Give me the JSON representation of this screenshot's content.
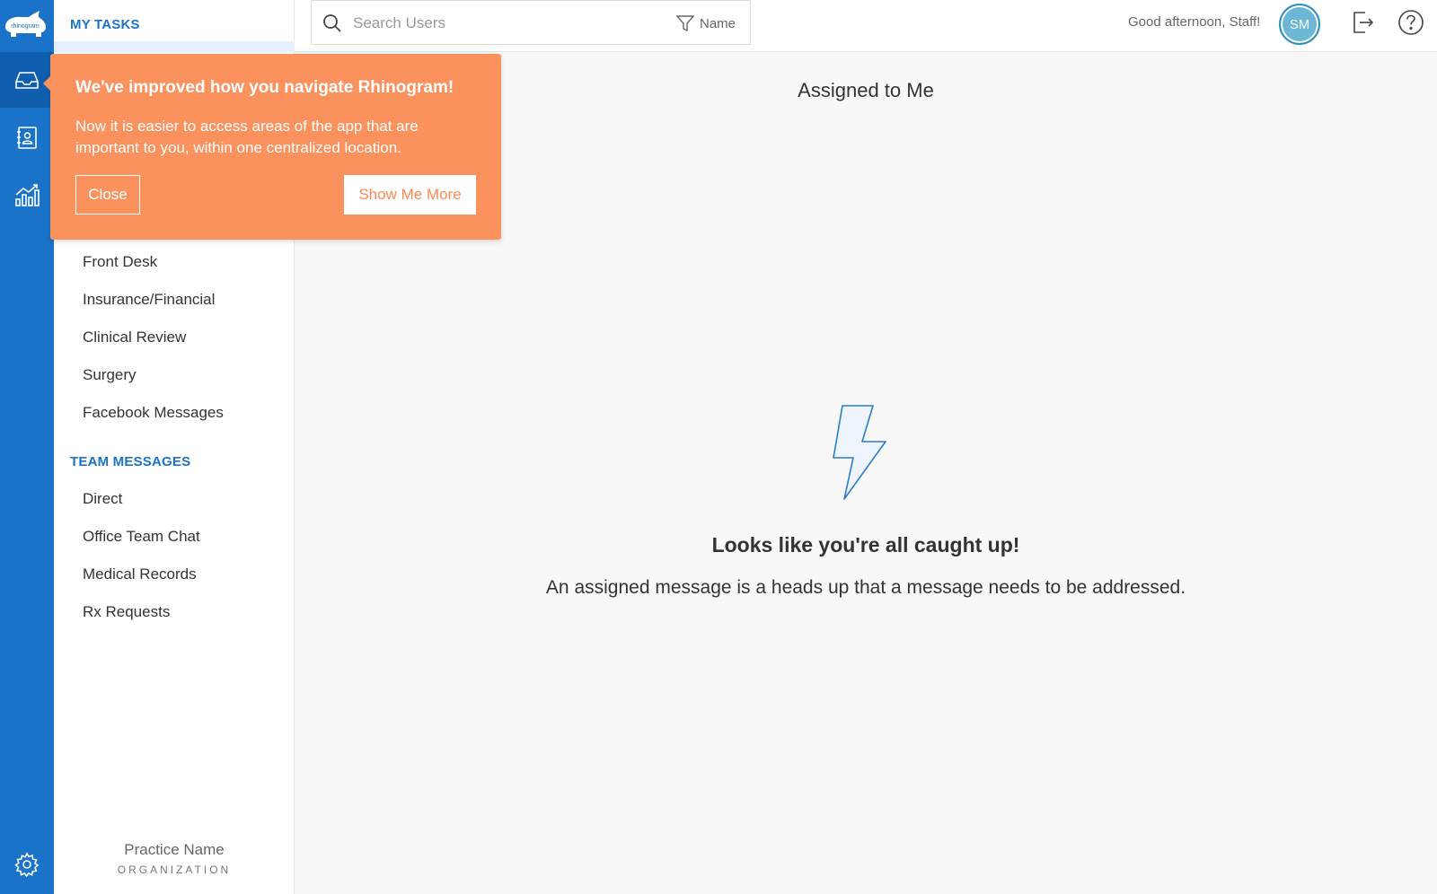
{
  "colors": {
    "brand": "#1a73c8",
    "popup": "#fb925e",
    "avatar": "#6cb7d6"
  },
  "rail": {
    "logo_text": "rhinogram",
    "items": [
      {
        "icon": "inbox-icon"
      },
      {
        "icon": "contacts-icon"
      },
      {
        "icon": "analytics-icon"
      }
    ],
    "settings_icon": "gear-icon"
  },
  "sidebar": {
    "my_tasks_title": "MY TASKS",
    "my_tasks_items": [
      "Front Desk",
      "Insurance/Financial",
      "Clinical Review",
      "Surgery",
      "Facebook Messages"
    ],
    "team_title": "TEAM MESSAGES",
    "team_items": [
      "Direct",
      "Office Team Chat",
      "Medical Records",
      "Rx Requests"
    ],
    "org_name": "Practice Name",
    "org_label": "ORGANIZATION"
  },
  "topbar": {
    "search_placeholder": "Search Users",
    "filter_label": "Name",
    "greeting": "Good afternoon, Staff!",
    "avatar_initials": "SM"
  },
  "main": {
    "title": "Assigned to Me",
    "empty_title": "Looks like you're all caught up!",
    "empty_subtitle": "An assigned message is a heads up that a message needs to be addressed."
  },
  "popup": {
    "title": "We've improved how you navigate Rhinogram!",
    "body": "Now it is easier to access areas of the app that are important to you, within one centralized location.",
    "close_label": "Close",
    "more_label": "Show Me More"
  }
}
